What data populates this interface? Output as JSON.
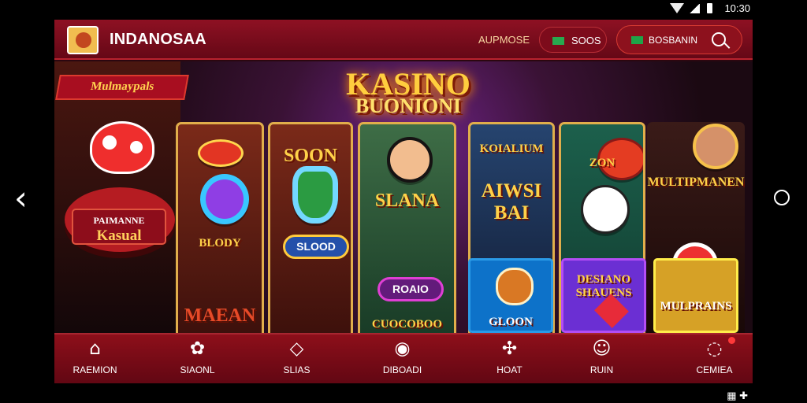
{
  "status": {
    "time": "10:30"
  },
  "header": {
    "brand": "INDANOSAA",
    "link": "AUPMOSE",
    "coins": "SOOS",
    "search": "BOSBANIN"
  },
  "promo": {
    "ribbon": "Mulmaypals",
    "sign_top": "PAIMANNE",
    "sign_bottom": "Kasual",
    "logo_top": "KASINO",
    "logo_sub": "BUONIONI"
  },
  "games": {
    "r1_label": "BLODY",
    "r2_top": "SOON",
    "r2_bottom": "SLOOD",
    "r3_title": "SLANA",
    "r3_button": "ROAIO",
    "r3_bottom": "CUOCOBOO",
    "r4_top": "KOIALIUM",
    "r4_main": "AIWSI BAI",
    "r4_bottom": "GLOON",
    "r5_top": "ZON",
    "r5_tile": "DESIANO SHAUENS",
    "r6_top": "MULTIPMANEN",
    "r6_tile": "MULPRAINS",
    "r1_bottom": "MAEAN"
  },
  "nav": [
    {
      "label": "RAEMION",
      "icon": "⌂"
    },
    {
      "label": "SIAONL",
      "icon": "✿"
    },
    {
      "label": "SLIAS",
      "icon": "◇"
    },
    {
      "label": "DIBOADI",
      "icon": "◉"
    },
    {
      "label": "HOAT",
      "icon": "✣"
    },
    {
      "label": "RUIN",
      "icon": "☺"
    },
    {
      "label": "CEMIEA",
      "icon": "◌"
    }
  ],
  "colors": {
    "accent": "#8d0f1a",
    "gold": "#ffd249"
  }
}
